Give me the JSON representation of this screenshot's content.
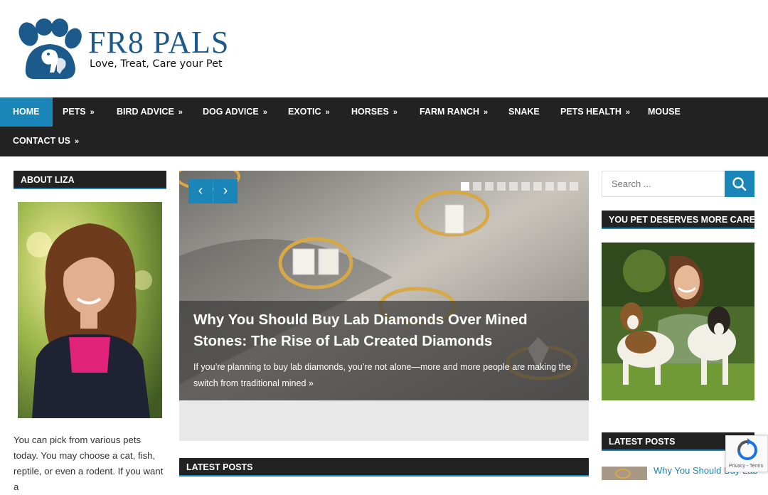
{
  "brand": {
    "name": "FR8 PALS",
    "tagline": "Love, Treat, Care your Pet",
    "color": "#1c5a8c"
  },
  "nav": {
    "items": [
      {
        "label": "HOME",
        "active": true,
        "has_sub": false
      },
      {
        "label": "PETS",
        "has_sub": true
      },
      {
        "label": "BIRD ADVICE",
        "has_sub": true
      },
      {
        "label": "DOG ADVICE",
        "has_sub": true
      },
      {
        "label": "EXOTIC",
        "has_sub": true
      },
      {
        "label": "HORSES",
        "has_sub": true
      },
      {
        "label": "FARM RANCH",
        "has_sub": true
      },
      {
        "label": "SNAKE",
        "has_sub": false
      },
      {
        "label": "PETS HEALTH",
        "has_sub": true
      },
      {
        "label": "MOUSE",
        "has_sub": false
      },
      {
        "label": "CONTACT US",
        "has_sub": true
      }
    ],
    "sub_arrow": "»"
  },
  "about": {
    "title": "ABOUT LIZA",
    "text": "You can pick from various pets today. You may choose a cat, fish, reptile, or even a rodent. If you want a"
  },
  "slider": {
    "prev": "‹",
    "next": "›",
    "slide_count": 10,
    "current": 1,
    "title": "Why You Should Buy Lab Diamonds Over Mined Stones: The Rise of Lab Created Diamonds",
    "excerpt": "If you’re planning to buy lab diamonds, you’re not alone—more and more people are making the switch from traditional mined",
    "more": "»"
  },
  "latest_mid": {
    "title": "LATEST POSTS"
  },
  "search": {
    "placeholder": "Search ..."
  },
  "care": {
    "title": "YOU PET DESERVES MORE CARE."
  },
  "latest_right": {
    "title": "LATEST POSTS",
    "first_post": "Why You Should Buy Lab"
  },
  "recaptcha": {
    "text": "Privacy - Terms"
  },
  "colors": {
    "accent": "#1a85b8",
    "dark": "#222222"
  },
  "icons": [
    "paw-logo-icon",
    "search-icon",
    "recaptcha-icon"
  ]
}
